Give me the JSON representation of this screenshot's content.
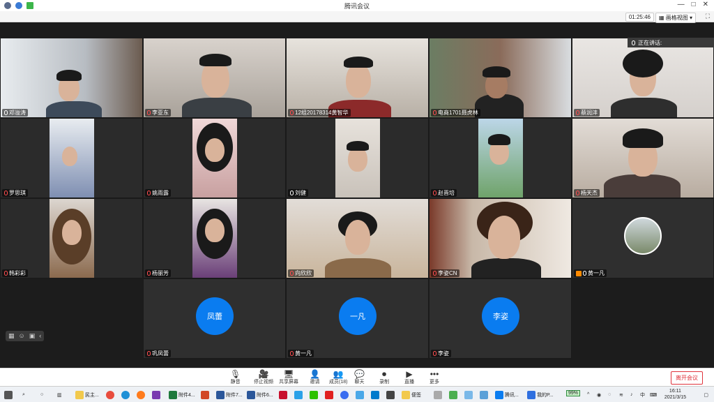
{
  "window": {
    "title": "腾讯会议",
    "controls": [
      "—",
      "□",
      "✕"
    ]
  },
  "toolbar": {
    "timer": "01:25:46",
    "view_label": "画格视图",
    "fullscreen": "⛶"
  },
  "speaking_label": "正在讲话:",
  "participants": [
    {
      "name": "邓溢涛"
    },
    {
      "name": "李亚东"
    },
    {
      "name": "12组20178314黄智华"
    },
    {
      "name": "电商1701聂虎林"
    },
    {
      "name": "蔡润沣"
    },
    {
      "name": "罗思琪"
    },
    {
      "name": "姚雨露"
    },
    {
      "name": "刘健"
    },
    {
      "name": "赵晋培"
    },
    {
      "name": "杨天杰"
    },
    {
      "name": "韩彩彩"
    },
    {
      "name": "杨丽芳"
    },
    {
      "name": "向欣欣"
    },
    {
      "name": "李姿CN"
    },
    {
      "name": "黄一凡"
    },
    {
      "name": "巩凤蕾",
      "avatar": "凤蕾"
    },
    {
      "name": "黄一凡",
      "avatar": "一凡"
    },
    {
      "name": "李姿",
      "avatar": "李姿"
    }
  ],
  "controls": [
    {
      "label": "静音",
      "icon": "microphone-icon",
      "glyph": "🎙"
    },
    {
      "label": "停止视频",
      "icon": "camera-icon",
      "glyph": "🎥"
    },
    {
      "label": "共享屏幕",
      "icon": "screen-share-icon",
      "glyph": "🖥"
    },
    {
      "label": "邀请",
      "icon": "invite-icon",
      "glyph": "👤"
    },
    {
      "label": "成员(18)",
      "icon": "members-icon",
      "glyph": "👥"
    },
    {
      "label": "聊天",
      "icon": "chat-icon",
      "glyph": "💬"
    },
    {
      "label": "录制",
      "icon": "record-icon",
      "glyph": "⏺"
    },
    {
      "label": "直播",
      "icon": "live-icon",
      "glyph": "▶"
    },
    {
      "label": "更多",
      "icon": "more-icon",
      "glyph": "•••"
    }
  ],
  "leave_label": "离开会议",
  "taskbar": {
    "items": [
      {
        "label": "民主...",
        "color": "#f2c94c"
      },
      {
        "label": "附件4...",
        "color": "#1f7a3d"
      },
      {
        "label": "附件7...",
        "color": "#2b579a"
      },
      {
        "label": "附件6...",
        "color": "#2b579a"
      },
      {
        "label": "便签",
        "color": "#f2c94c"
      },
      {
        "label": "腾讯...",
        "color": "#0a7cf0"
      },
      {
        "label": "我的P...",
        "color": "#2f6fdf"
      }
    ],
    "battery": "99%",
    "ime": "中",
    "time": "16:11",
    "date": "2021/3/15"
  }
}
